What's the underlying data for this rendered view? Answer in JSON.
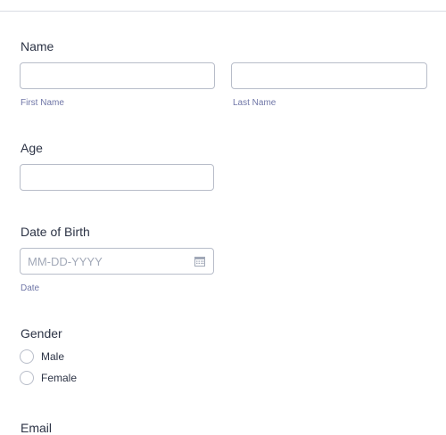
{
  "form": {
    "name": {
      "label": "Name",
      "first_label": "First Name",
      "last_label": "Last Name",
      "first_value": "",
      "last_value": ""
    },
    "age": {
      "label": "Age",
      "value": ""
    },
    "dob": {
      "label": "Date of Birth",
      "placeholder": "MM-DD-YYYY",
      "sublabel": "Date",
      "icon": "calendar-icon"
    },
    "gender": {
      "label": "Gender",
      "options": [
        {
          "label": "Male",
          "selected": false
        },
        {
          "label": "Female",
          "selected": false
        }
      ]
    },
    "email": {
      "label": "Email"
    }
  },
  "colors": {
    "text": "#2c3345",
    "sublabel": "#6f76a7",
    "border": "#b8bdc9",
    "placeholder": "#a2a9b8",
    "divider": "#dadde3"
  }
}
